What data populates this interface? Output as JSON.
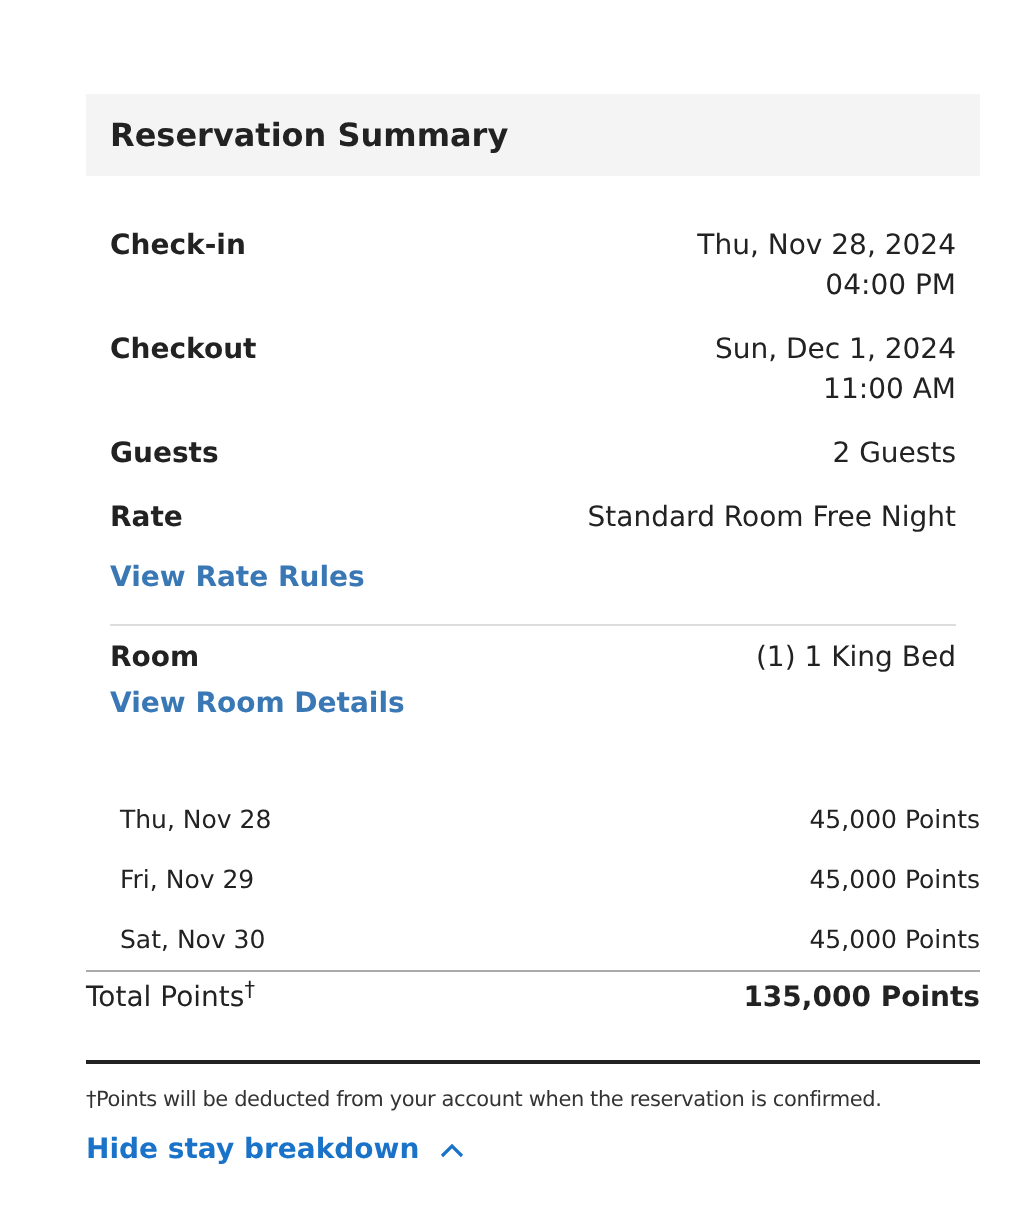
{
  "title": "Reservation Summary",
  "details": [
    {
      "label": "Check-in",
      "value": [
        "Thu, Nov 28, 2024",
        "04:00 PM"
      ]
    },
    {
      "label": "Checkout",
      "value": [
        "Sun, Dec 1, 2024",
        "11:00 AM"
      ]
    },
    {
      "label": "Guests",
      "value": [
        "2 Guests"
      ]
    },
    {
      "label": "Rate",
      "value": [
        "Standard Room Free Night"
      ],
      "link": "View Rate Rules"
    }
  ],
  "room": {
    "label": "Room",
    "value": "(1) 1 King Bed",
    "link": "View Room Details"
  },
  "nights": [
    {
      "date": "Thu, Nov 28",
      "points": "45,000 Points"
    },
    {
      "date": "Fri, Nov 29",
      "points": "45,000 Points"
    },
    {
      "date": "Sat, Nov 30",
      "points": "45,000 Points"
    }
  ],
  "total": {
    "label": "Total Points$^{†}$",
    "value": "135,000 Points"
  },
  "footnote": "†Points will be deducted from your account when the reservation is confirmed.",
  "breakdown_toggle": {
    "label": "Hide stay breakdown",
    "expanded": true
  }
}
